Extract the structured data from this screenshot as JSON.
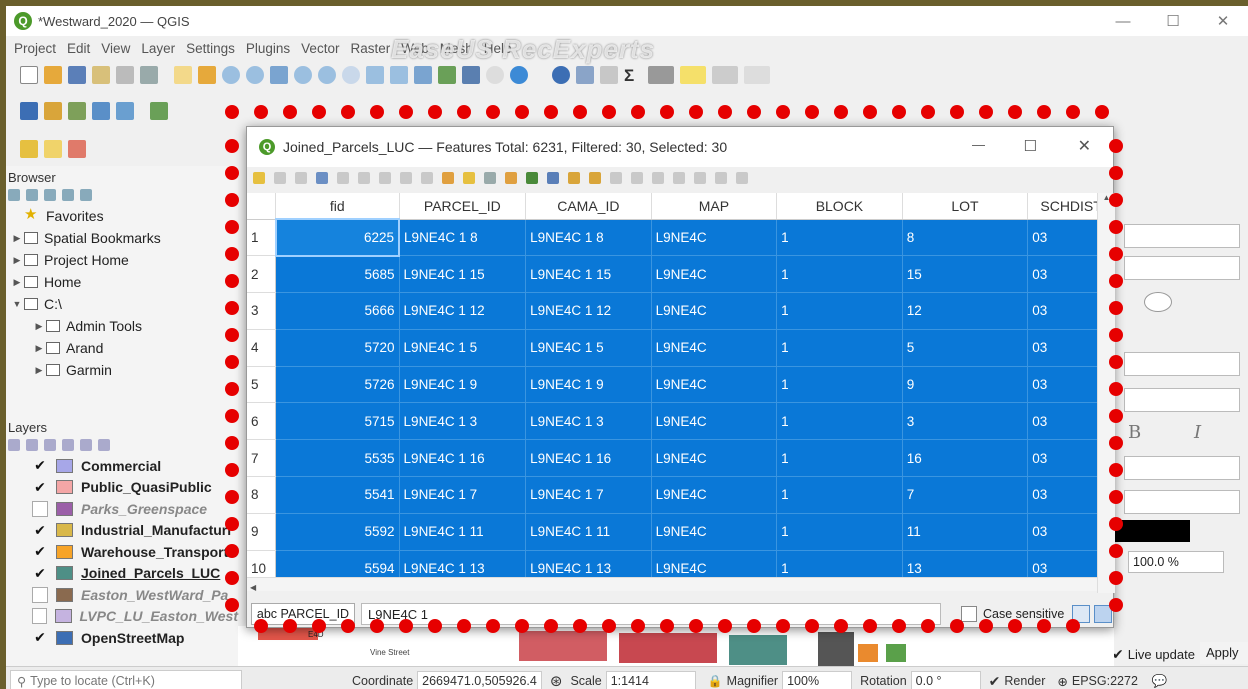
{
  "window": {
    "title": "*Westward_2020 — QGIS",
    "logo": "Q",
    "controls": [
      "—",
      "☐",
      "✕"
    ]
  },
  "watermark": "EaseUS RecExperts",
  "menu": [
    "Project",
    "Edit",
    "View",
    "Layer",
    "Settings",
    "Plugins",
    "Vector",
    "Raster",
    "Web",
    "Mesh",
    "Help"
  ],
  "browser": {
    "title": "Browser",
    "items": [
      {
        "label": "Favorites",
        "icon": "star-icon",
        "arrow": ""
      },
      {
        "label": "Spatial Bookmarks",
        "icon": "bookmark-icon",
        "arrow": "▶"
      },
      {
        "label": "Project Home",
        "icon": "project-home-icon",
        "arrow": "▶"
      },
      {
        "label": "Home",
        "icon": "home-icon",
        "arrow": "▶"
      },
      {
        "label": "C:\\",
        "icon": "drive-icon",
        "arrow": "▼"
      },
      {
        "label": "Admin Tools",
        "icon": "folder-icon",
        "arrow": "▶"
      },
      {
        "label": "Arand",
        "icon": "folder-icon",
        "arrow": "▶"
      },
      {
        "label": "Garmin",
        "icon": "folder-icon",
        "arrow": "▶"
      }
    ]
  },
  "layers": {
    "title": "Layers",
    "items": [
      {
        "label": "Commercial",
        "checked": true,
        "color": "#a7a7e8"
      },
      {
        "label": "Public_QuasiPublic",
        "checked": true,
        "color": "#f4a6a6"
      },
      {
        "label": "Parks_Greenspace",
        "checked": false,
        "color": "#9b5fa8"
      },
      {
        "label": "Industrial_Manufacturi",
        "checked": true,
        "color": "#d9b84a"
      },
      {
        "label": "Warehouse_Transporta",
        "checked": true,
        "color": "#f7a428"
      },
      {
        "label": "Joined_Parcels_LUC",
        "checked": true,
        "color": "#4e8f86"
      },
      {
        "label": "Easton_WestWard_Pa",
        "checked": false,
        "color": "#8a6a4f"
      },
      {
        "label": "LVPC_LU_Easton_West",
        "checked": false,
        "color": "#c5b3e0"
      },
      {
        "label": "OpenStreetMap",
        "checked": true,
        "color": "#3c6eb4"
      }
    ]
  },
  "dialog": {
    "title": "Joined_Parcels_LUC — Features Total: 6231, Filtered: 30, Selected: 30",
    "columns": [
      "fid",
      "PARCEL_ID",
      "CAMA_ID",
      "MAP",
      "BLOCK",
      "LOT",
      "SCHDIST"
    ],
    "rows": [
      {
        "n": "1",
        "fid": "6225",
        "parcel": "L9NE4C 1 8",
        "cama": "L9NE4C 1 8",
        "map": "L9NE4C",
        "block": "1",
        "lot": "8",
        "sch": "03"
      },
      {
        "n": "2",
        "fid": "5685",
        "parcel": "L9NE4C 1 15",
        "cama": "L9NE4C 1 15",
        "map": "L9NE4C",
        "block": "1",
        "lot": "15",
        "sch": "03"
      },
      {
        "n": "3",
        "fid": "5666",
        "parcel": "L9NE4C 1 12",
        "cama": "L9NE4C 1 12",
        "map": "L9NE4C",
        "block": "1",
        "lot": "12",
        "sch": "03"
      },
      {
        "n": "4",
        "fid": "5720",
        "parcel": "L9NE4C 1 5",
        "cama": "L9NE4C 1 5",
        "map": "L9NE4C",
        "block": "1",
        "lot": "5",
        "sch": "03"
      },
      {
        "n": "5",
        "fid": "5726",
        "parcel": "L9NE4C 1 9",
        "cama": "L9NE4C 1 9",
        "map": "L9NE4C",
        "block": "1",
        "lot": "9",
        "sch": "03"
      },
      {
        "n": "6",
        "fid": "5715",
        "parcel": "L9NE4C 1 3",
        "cama": "L9NE4C 1 3",
        "map": "L9NE4C",
        "block": "1",
        "lot": "3",
        "sch": "03"
      },
      {
        "n": "7",
        "fid": "5535",
        "parcel": "L9NE4C 1 16",
        "cama": "L9NE4C 1 16",
        "map": "L9NE4C",
        "block": "1",
        "lot": "16",
        "sch": "03"
      },
      {
        "n": "8",
        "fid": "5541",
        "parcel": "L9NE4C 1 7",
        "cama": "L9NE4C 1 7",
        "map": "L9NE4C",
        "block": "1",
        "lot": "7",
        "sch": "03"
      },
      {
        "n": "9",
        "fid": "5592",
        "parcel": "L9NE4C 1 11",
        "cama": "L9NE4C 1 11",
        "map": "L9NE4C",
        "block": "1",
        "lot": "11",
        "sch": "03"
      },
      {
        "n": "10",
        "fid": "5594",
        "parcel": "L9NE4C 1 13",
        "cama": "L9NE4C 1 13",
        "map": "L9NE4C",
        "block": "1",
        "lot": "13",
        "sch": "03"
      }
    ],
    "filter_field": "abc PARCEL_ID",
    "filter_value": "L9NE4C 1",
    "case_sensitive": "Case sensitive"
  },
  "right_panel": {
    "opacity": "100.0 %",
    "live_update": "Live update",
    "apply": "Apply"
  },
  "map_labels": [
    "Vine Street",
    "E4D"
  ],
  "statusbar": {
    "locate_placeholder": "Type to locate (Ctrl+K)",
    "coordinate_label": "Coordinate",
    "coordinate": "2669471.0,505926.4",
    "scale_label": "Scale",
    "scale": "1:1414",
    "magnifier_label": "Magnifier",
    "magnifier": "100%",
    "rotation_label": "Rotation",
    "rotation": "0.0 °",
    "render": "Render",
    "crs": "EPSG:2272"
  },
  "colors": {
    "selection": "#0a78d7",
    "annotation_dot": "#e60000",
    "qgis_green": "#4c9a2a"
  }
}
